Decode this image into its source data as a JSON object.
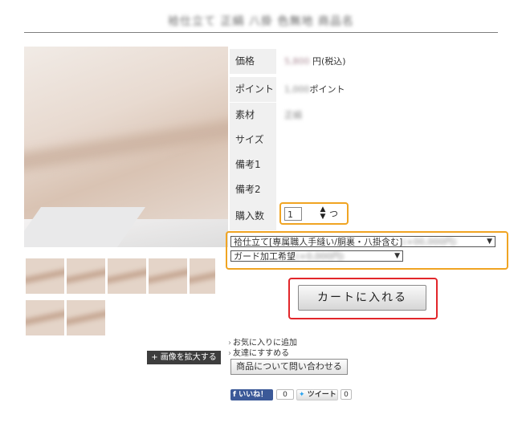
{
  "product": {
    "title": "袷仕立て 正絹 八掛 色無地 商品名"
  },
  "specs": [
    {
      "label": "価格",
      "value": "5,800",
      "suffix": "円(税込)"
    },
    {
      "label": "ポイント",
      "value": "1,000",
      "suffix": "ポイント"
    },
    {
      "label": "素材",
      "value": "正絹",
      "suffix": ""
    },
    {
      "label": "サイズ",
      "value": "",
      "suffix": ""
    },
    {
      "label": "備考1",
      "value": "",
      "suffix": ""
    },
    {
      "label": "備考2",
      "value": "",
      "suffix": ""
    },
    {
      "label": "購入数",
      "value": "",
      "suffix": ""
    }
  ],
  "quantity": {
    "value": "1",
    "unit": "つ"
  },
  "options": {
    "tailoring": "袷仕立て[専属職人手縫い/胴裏・八掛含む]",
    "tailoring_blurred": "(+00,000円)",
    "guard": "ガード加工希望",
    "guard_blurred": "(+0,000円)"
  },
  "cart_button": "カートに入れる",
  "expand_button": "+ 画像を拡大する",
  "links": {
    "favorite": "お気に入りに追加",
    "recommend": "友達にすすめる"
  },
  "inquiry_button": "商品について問い合わせる",
  "social": {
    "facebook_label": "いいね！",
    "facebook_count": "0",
    "twitter_label": "ツイート",
    "twitter_count": "0"
  },
  "colors": {
    "highlight_orange": "#f0a422",
    "highlight_red": "#e2262a",
    "facebook_blue": "#3b5998",
    "twitter_blue": "#2aa3ef"
  }
}
